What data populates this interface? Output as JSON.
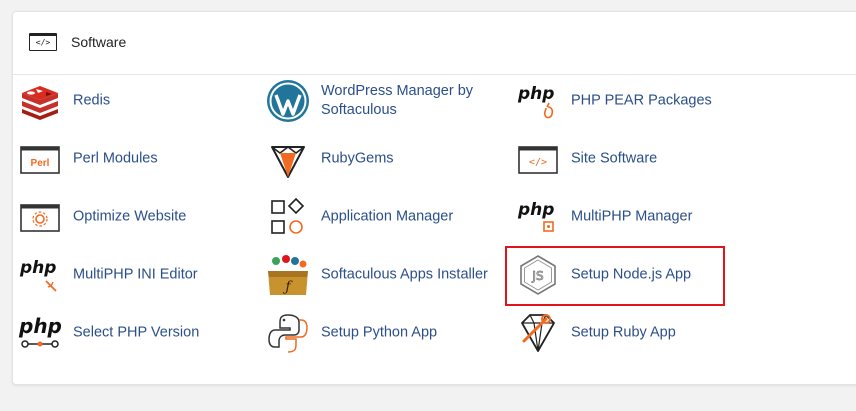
{
  "section": {
    "title": "Software",
    "icon": "code-window-icon"
  },
  "items": [
    {
      "label": "Redis",
      "icon": "redis-icon"
    },
    {
      "label": "WordPress Manager by Softaculous",
      "icon": "wordpress-icon"
    },
    {
      "label": "PHP PEAR Packages",
      "icon": "php-pear-icon"
    },
    {
      "label": "Perl Modules",
      "icon": "perl-icon",
      "icon_text": "Perl"
    },
    {
      "label": "RubyGems",
      "icon": "rubygems-icon"
    },
    {
      "label": "Site Software",
      "icon": "site-software-icon"
    },
    {
      "label": "Optimize Website",
      "icon": "optimize-website-icon"
    },
    {
      "label": "Application Manager",
      "icon": "application-manager-icon"
    },
    {
      "label": "MultiPHP Manager",
      "icon": "multiphp-manager-icon"
    },
    {
      "label": "MultiPHP INI Editor",
      "icon": "multiphp-ini-icon"
    },
    {
      "label": "Softaculous Apps Installer",
      "icon": "softaculous-icon"
    },
    {
      "label": "Setup Node.js App",
      "icon": "nodejs-icon",
      "highlighted": true
    },
    {
      "label": "Select PHP Version",
      "icon": "php-version-icon"
    },
    {
      "label": "Setup Python App",
      "icon": "python-icon"
    },
    {
      "label": "Setup Ruby App",
      "icon": "ruby-icon"
    }
  ],
  "icon_text": {
    "php": "php",
    "code": "</>"
  },
  "colors": {
    "link": "#2b4f8a",
    "highlight_border": "#e2141b",
    "accent_orange": "#f26a21",
    "redis_red": "#c6302b"
  }
}
